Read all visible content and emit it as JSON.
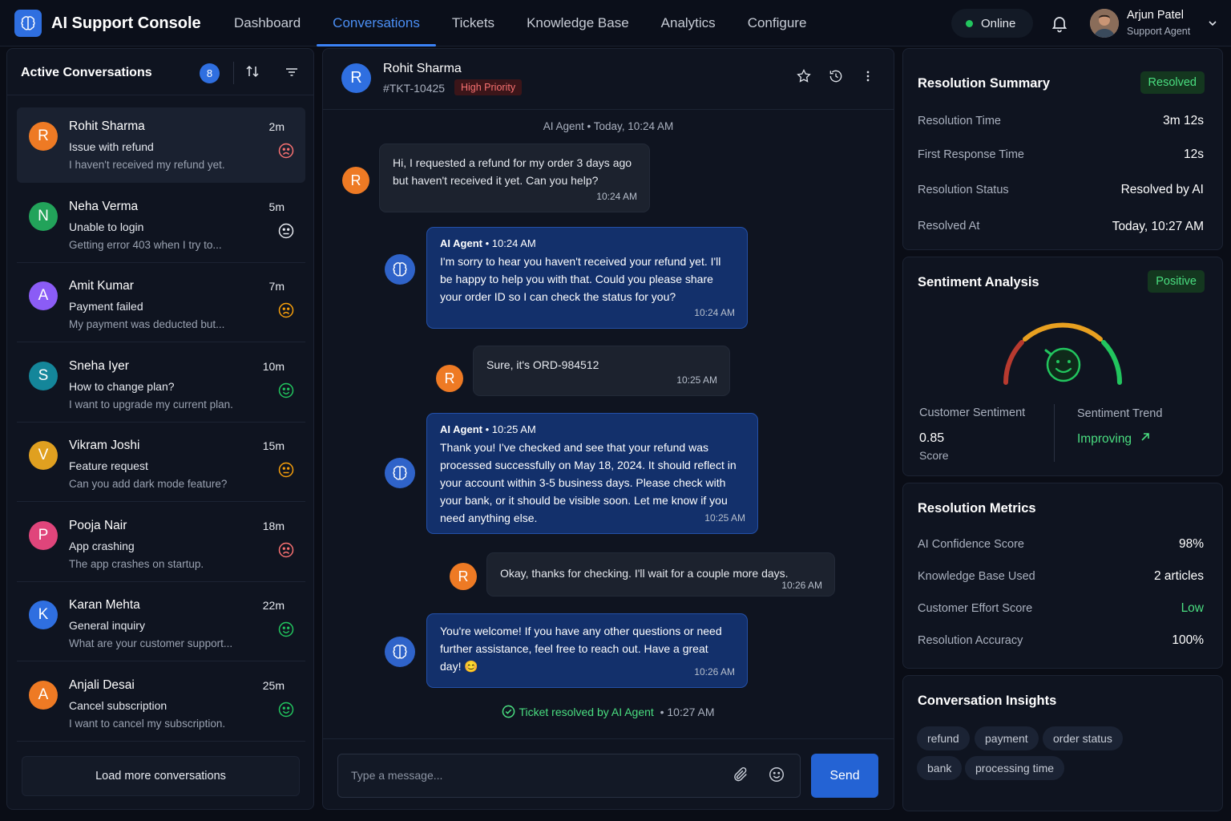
{
  "app": {
    "title": "AI Support Console"
  },
  "nav": [
    "Dashboard",
    "Conversations",
    "Tickets",
    "Knowledge Base",
    "Analytics",
    "Configure"
  ],
  "status": "Online",
  "user": {
    "name": "Arjun Patel",
    "role": "Support Agent"
  },
  "left": {
    "title": "Active Conversations",
    "count": "8",
    "items": [
      {
        "initial": "R",
        "name": "Rohit Sharma",
        "subject": "Issue with refund",
        "preview": "I haven't received my refund yet.",
        "time": "2m",
        "sentiment": "sad-face-icon",
        "color": "#ee7a24",
        "face": "#f87171"
      },
      {
        "initial": "N",
        "name": "Neha Verma",
        "subject": "Unable to login",
        "preview": "Getting error 403 when I try to...",
        "time": "5m",
        "sentiment": "neutral-face-icon",
        "color": "#22a35a",
        "face": "#e6e9ef"
      },
      {
        "initial": "A",
        "name": "Amit Kumar",
        "subject": "Payment failed",
        "preview": "My payment was deducted but...",
        "time": "7m",
        "sentiment": "sad-face-icon",
        "color": "#8b5cf6",
        "face": "#f59e0b"
      },
      {
        "initial": "S",
        "name": "Sneha Iyer",
        "subject": "How to change plan?",
        "preview": "I want to upgrade my current plan.",
        "time": "10m",
        "sentiment": "happy-face-icon",
        "color": "#14869a",
        "face": "#22c55e"
      },
      {
        "initial": "V",
        "name": "Vikram Joshi",
        "subject": "Feature request",
        "preview": "Can you add dark mode feature?",
        "time": "15m",
        "sentiment": "neutral-face-icon",
        "color": "#e0a020",
        "face": "#f59e0b"
      },
      {
        "initial": "P",
        "name": "Pooja Nair",
        "subject": "App crashing",
        "preview": "The app crashes on startup.",
        "time": "18m",
        "sentiment": "sad-face-icon",
        "color": "#e0457b",
        "face": "#f87171"
      },
      {
        "initial": "K",
        "name": "Karan Mehta",
        "subject": "General inquiry",
        "preview": "What are your customer support...",
        "time": "22m",
        "sentiment": "happy-face-icon",
        "color": "#2f6fe0",
        "face": "#22c55e"
      },
      {
        "initial": "A",
        "name": "Anjali Desai",
        "subject": "Cancel subscription",
        "preview": "I want to cancel my subscription.",
        "time": "25m",
        "sentiment": "happy-face-icon",
        "color": "#ee7a24",
        "face": "#22c55e"
      }
    ],
    "load_more": "Load more conversations"
  },
  "chat": {
    "initial": "R",
    "name": "Rohit Sharma",
    "ticket": "#TKT-10425",
    "priority": "High Priority",
    "system": "AI Agent • Today, 10:24 AM",
    "messages": [
      {
        "from": "user",
        "text": "Hi, I requested a refund for my order 3 days ago but haven't received it yet. Can you help?",
        "time": "10:24 AM"
      },
      {
        "from": "ai",
        "sender": "AI Agent",
        "stamp": "10:24 AM",
        "text": "I'm sorry to hear you haven't received your refund yet. I'll be happy to help you with that. Could you please share your order ID so I can check the status for you?",
        "time": "10:24 AM"
      },
      {
        "from": "user",
        "text": "Sure, it's ORD-984512",
        "time": "10:25 AM"
      },
      {
        "from": "ai",
        "sender": "AI Agent",
        "stamp": "10:25 AM",
        "text": "Thank you! I've checked and see that your refund was processed successfully on May 18, 2024. It should reflect in your account within 3-5 business days. Please check with your bank, or it should be visible soon. Let me know if you need anything else.",
        "time": "10:25 AM"
      },
      {
        "from": "user",
        "text": "Okay, thanks for checking. I'll wait for a couple more days.",
        "time": "10:26 AM"
      },
      {
        "from": "ai",
        "text": "You're welcome! If you have any other questions or need further assistance, feel free to reach out. Have a great day! 😊",
        "time": "10:26 AM"
      }
    ],
    "resolved": "Ticket resolved by AI Agent",
    "resolved_time": "• 10:27 AM",
    "input_placeholder": "Type a message...",
    "send": "Send"
  },
  "resolution_summary": {
    "title": "Resolution Summary",
    "badge": "Resolved",
    "rows": [
      {
        "label": "Resolution Time",
        "value": "3m 12s"
      },
      {
        "label": "First Response Time",
        "value": "12s"
      },
      {
        "label": "Resolution Status",
        "value": "Resolved by AI"
      },
      {
        "label": "Resolved At",
        "value": "Today, 10:27 AM"
      }
    ]
  },
  "sentiment": {
    "title": "Sentiment Analysis",
    "badge": "Positive",
    "gauge_value": 0.85,
    "customer_label": "Customer Sentiment",
    "score": "0.85",
    "score_label": "Score",
    "trend_label": "Sentiment Trend",
    "trend": "Improving"
  },
  "metrics": {
    "title": "Resolution Metrics",
    "rows": [
      {
        "label": "AI Confidence Score",
        "value": "98%"
      },
      {
        "label": "Knowledge Base Used",
        "value": "2 articles"
      },
      {
        "label": "Customer Effort Score",
        "value": "Low"
      },
      {
        "label": "Resolution Accuracy",
        "value": "100%"
      }
    ]
  },
  "insights": {
    "title": "Conversation Insights",
    "tags": [
      "refund",
      "payment",
      "order status",
      "bank",
      "processing time"
    ]
  },
  "colors": {
    "accent": "#3b82f6",
    "positive": "#4ade80",
    "danger": "#f87171"
  }
}
